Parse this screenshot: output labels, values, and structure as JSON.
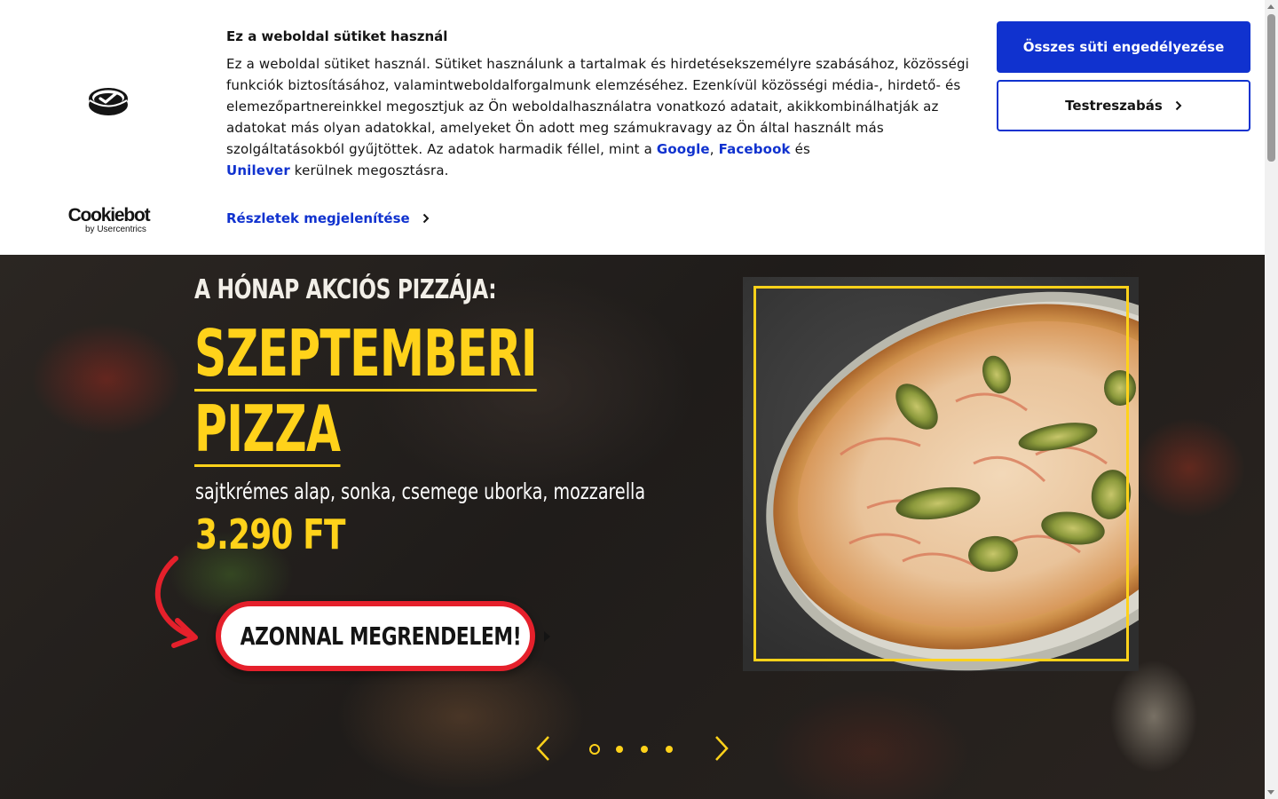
{
  "cookie_banner": {
    "brand": {
      "name": "Cookiebot",
      "byline": "by Usercentrics"
    },
    "title": "Ez a weboldal sütiket használ",
    "body_part1": "Ez a weboldal sütiket használ. Sütiket használunk a tartalmak és hirdetésekszemélyre szabásához, közösségi funkciók biztosításához, valamintweboldalforgalmunk elemzéséhez. Ezenkívül közösségi média-, hirdető- és elemezőpartnereinkkel megosztjuk az Ön weboldalhasználatra vonatkozó adatait, akikkombinálhatják az adatokat más olyan adatokkal, amelyeket Ön adott meg számukravagy az Ön által használt más szolgáltatásokból gyűjtöttek. Az adatok harmadik féllel, mint a ",
    "link_google": "Google",
    "sep1": ", ",
    "link_facebook": "Facebook",
    "sep2": " és ",
    "link_unilever": "Unilever",
    "body_part2": " kerülnek megosztásra.",
    "details_label": "Részletek megjelenítése",
    "allow_all_label": "Összes süti engedélyezése",
    "customize_label": "Testreszabás",
    "accent_color": "#1032cf"
  },
  "hero": {
    "kicker": "A HÓNAP AKCIÓS PIZZÁJA:",
    "title_line1": "SZEPTEMBERI",
    "title_line2": "PIZZA",
    "description": "sajtkrémes alap, sonka, csemege uborka, mozzarella",
    "price": "3.290 FT",
    "order_button_label": "AZONNAL MEGRENDELEM!",
    "accent_yellow": "#ffd21a",
    "accent_red": "#e5202b"
  },
  "carousel": {
    "slide_count": 4,
    "active_index": 0
  }
}
